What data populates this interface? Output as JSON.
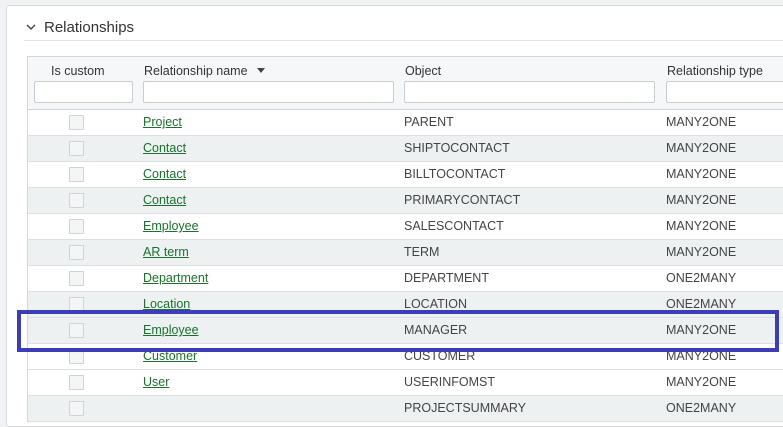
{
  "section": {
    "title": "Relationships"
  },
  "columns": {
    "is_custom": "Is custom",
    "name": "Relationship name",
    "object": "Object",
    "type": "Relationship type"
  },
  "rows": [
    {
      "name": "Project",
      "object": "PARENT",
      "type": "MANY2ONE"
    },
    {
      "name": "Contact",
      "object": "SHIPTOCONTACT",
      "type": "MANY2ONE"
    },
    {
      "name": "Contact",
      "object": "BILLTOCONTACT",
      "type": "MANY2ONE"
    },
    {
      "name": "Contact",
      "object": "PRIMARYCONTACT",
      "type": "MANY2ONE"
    },
    {
      "name": "Employee",
      "object": "SALESCONTACT",
      "type": "MANY2ONE"
    },
    {
      "name": "AR term",
      "object": "TERM",
      "type": "MANY2ONE"
    },
    {
      "name": "Department",
      "object": "DEPARTMENT",
      "type": "ONE2MANY"
    },
    {
      "name": "Location",
      "object": "LOCATION",
      "type": "ONE2MANY"
    },
    {
      "name": "Employee",
      "object": "MANAGER",
      "type": "MANY2ONE"
    },
    {
      "name": "Customer",
      "object": "CUSTOMER",
      "type": "MANY2ONE"
    },
    {
      "name": "User",
      "object": "USERINFOMST",
      "type": "MANY2ONE"
    },
    {
      "name": "",
      "object": "PROJECTSUMMARY",
      "type": "ONE2MANY"
    }
  ],
  "colors": {
    "link": "#1e6f30",
    "highlight": "#3d3db8",
    "alt_row": "#edf1f2"
  },
  "icons": {
    "section_toggle": "chevron-down-icon",
    "sort": "sort-descending-icon"
  }
}
